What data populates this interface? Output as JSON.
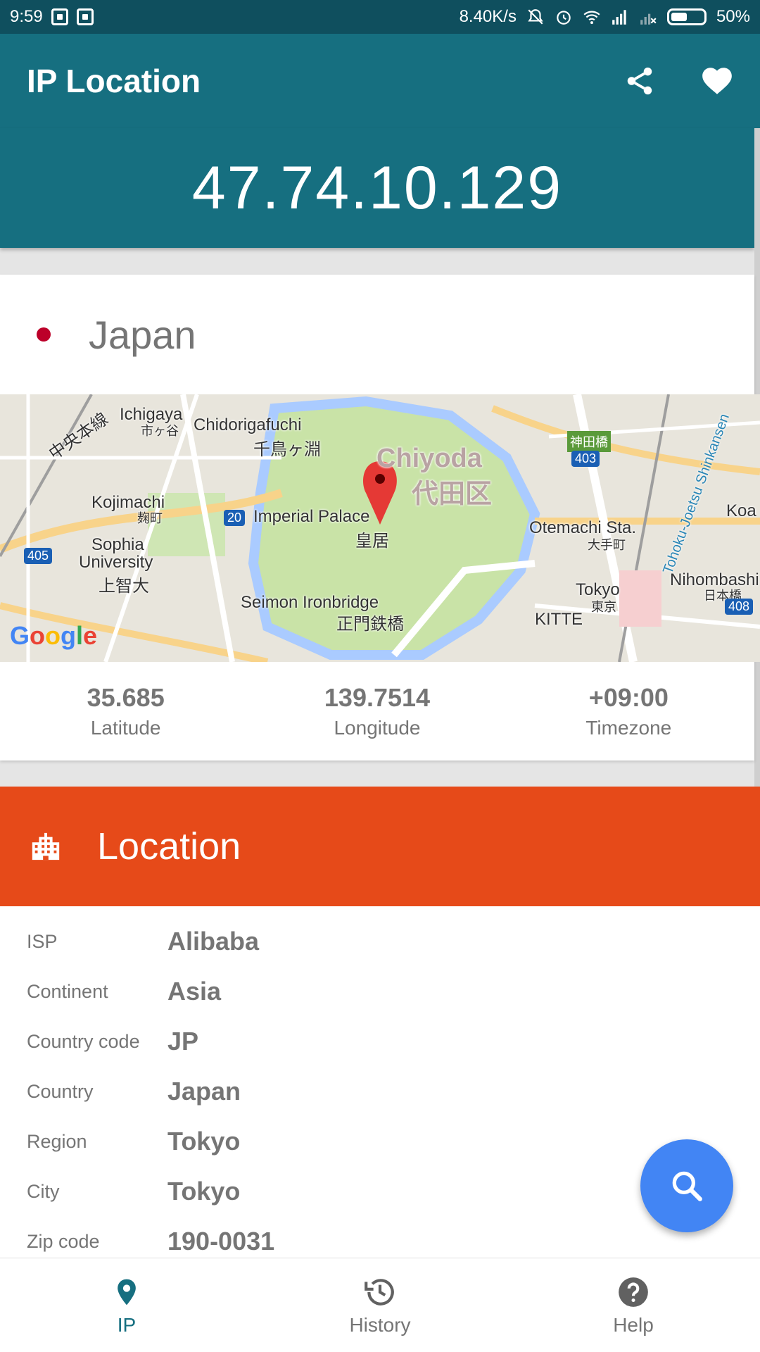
{
  "status_bar": {
    "time": "9:59",
    "network_speed": "8.40K/s",
    "battery": "50%"
  },
  "app_bar": {
    "title": "IP Location",
    "share_icon": "share-icon",
    "favorite_icon": "heart-icon"
  },
  "ip": "47.74.10.129",
  "country": {
    "name": "Japan",
    "flag_color": "#bc0029"
  },
  "map": {
    "labels": [
      "Chidorigafuchi",
      "千鳥ヶ淵",
      "Chiyoda",
      "代田区",
      "Imperial Palace",
      "皇居",
      "Ichigaya",
      "市ヶ谷",
      "Kojimachi",
      "麹町",
      "Sophia",
      "University",
      "上智大",
      "Seimon Ironbridge",
      "正門鉄橋",
      "Otemachi Sta.",
      "大手町",
      "Tokyo",
      "東京",
      "KITTE",
      "Nihombashi",
      "日本橋",
      "神田橋",
      "中央本線",
      "Tohoku-Joetsu Shinkansen",
      "Koa",
      "403",
      "405",
      "408",
      "20"
    ],
    "google": "Google"
  },
  "stats": [
    {
      "value": "35.685",
      "label": "Latitude"
    },
    {
      "value": "139.7514",
      "label": "Longitude"
    },
    {
      "value": "+09:00",
      "label": "Timezone"
    }
  ],
  "location_section": {
    "title": "Location",
    "icon": "building-icon",
    "rows": [
      {
        "label": "ISP",
        "value": "Alibaba"
      },
      {
        "label": "Continent",
        "value": "Asia"
      },
      {
        "label": "Country code",
        "value": "JP"
      },
      {
        "label": "Country",
        "value": "Japan"
      },
      {
        "label": "Region",
        "value": "Tokyo"
      },
      {
        "label": "City",
        "value": "Tokyo"
      },
      {
        "label": "Zip code",
        "value": "190-0031"
      }
    ]
  },
  "fab": {
    "icon": "search-icon",
    "color": "#4285f4"
  },
  "bottom_nav": [
    {
      "label": "IP",
      "icon": "location-pin-icon",
      "active": true
    },
    {
      "label": "History",
      "icon": "history-icon",
      "active": false
    },
    {
      "label": "Help",
      "icon": "help-icon",
      "active": false
    }
  ],
  "colors": {
    "primary": "#166f80",
    "status_bar": "#0f4f5e",
    "accent": "#e64a19"
  }
}
